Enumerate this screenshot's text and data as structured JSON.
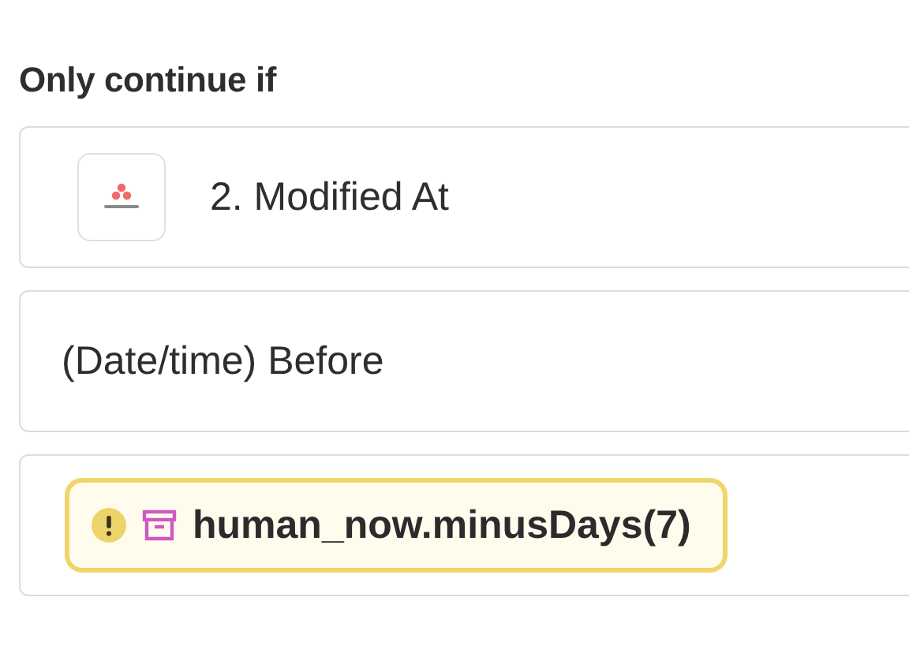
{
  "title": "Only continue if",
  "field": {
    "label": "2. Modified At"
  },
  "condition": {
    "label": "(Date/time) Before"
  },
  "value": {
    "label": "human_now.minusDays(7)",
    "warning": true
  }
}
